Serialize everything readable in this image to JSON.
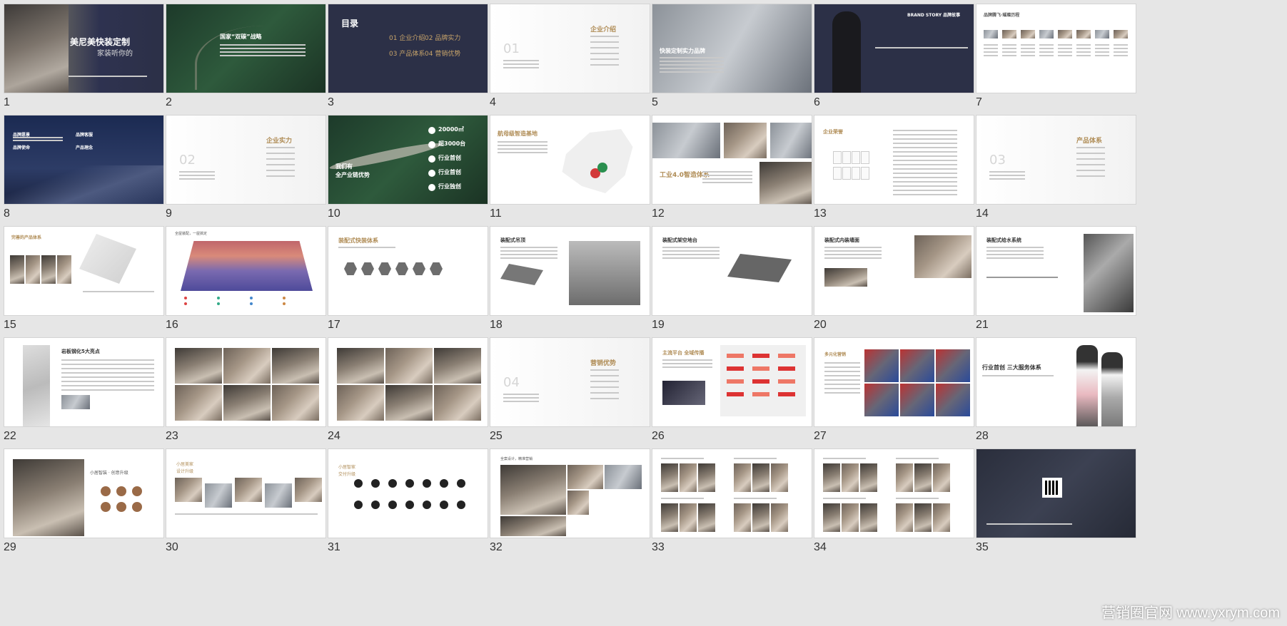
{
  "slides": [
    {
      "num": "1",
      "title": "美尼美快装定制",
      "subtitle": "家装听你的"
    },
    {
      "num": "2",
      "title": "国家“双碳”战略"
    },
    {
      "num": "3",
      "title": "目录",
      "items": [
        "01 企业介绍",
        "02 品牌实力",
        "03 产品体系",
        "04 营销优势"
      ]
    },
    {
      "num": "4",
      "big": "01",
      "title": "企业介绍"
    },
    {
      "num": "5",
      "title": "快装定制实力品牌"
    },
    {
      "num": "6",
      "title": "BRAND STORY 品牌故事"
    },
    {
      "num": "7",
      "title": "品牌腾飞·璀璨历程"
    },
    {
      "num": "8",
      "labels": [
        "品牌愿景",
        "品牌使命",
        "品牌客服",
        "产品理念"
      ]
    },
    {
      "num": "9",
      "big": "02",
      "title": "企业实力"
    },
    {
      "num": "10",
      "title": "我们有",
      "subtitle": "全产业链优势",
      "stats": [
        "20000㎡",
        "超3000台",
        "行业首创",
        "行业首创",
        "行业独创"
      ]
    },
    {
      "num": "11",
      "title": "航母级智造基地"
    },
    {
      "num": "12",
      "title": "工业4.0智造体系"
    },
    {
      "num": "13",
      "title": "企业荣誉"
    },
    {
      "num": "14",
      "big": "03",
      "title": "产品体系"
    },
    {
      "num": "15",
      "title": "完善的产品体系"
    },
    {
      "num": "16",
      "title": "全屋装配，一屋搞定"
    },
    {
      "num": "17",
      "title": "装配式快装体系"
    },
    {
      "num": "18",
      "title": "装配式吊顶"
    },
    {
      "num": "19",
      "title": "装配式架空地台"
    },
    {
      "num": "20",
      "title": "装配式内装墙面"
    },
    {
      "num": "21",
      "title": "装配式给水系统"
    },
    {
      "num": "22",
      "title": "岩板钢化5大亮点"
    },
    {
      "num": "23"
    },
    {
      "num": "24"
    },
    {
      "num": "25",
      "big": "04",
      "title": "营销优势"
    },
    {
      "num": "26",
      "title": "主流平台 全域传播"
    },
    {
      "num": "27",
      "title": "多元化营销"
    },
    {
      "num": "28",
      "title": "行业首创 三大服务体系"
    },
    {
      "num": "29",
      "title": "小居智装 · 创意升级"
    },
    {
      "num": "30",
      "title": "小居美家",
      "subtitle": "设计升级"
    },
    {
      "num": "31",
      "title": "小居智家",
      "subtitle": "交付升级"
    },
    {
      "num": "32",
      "title": "全案设计，精准营销"
    },
    {
      "num": "33"
    },
    {
      "num": "34"
    },
    {
      "num": "35"
    }
  ],
  "watermark": "营销圈官网 www.yxrym.com",
  "colors": {
    "background": "#e6e6e6",
    "navy": "#2c3047",
    "gold": "#b08d57",
    "forest": "#2e5a3c"
  }
}
